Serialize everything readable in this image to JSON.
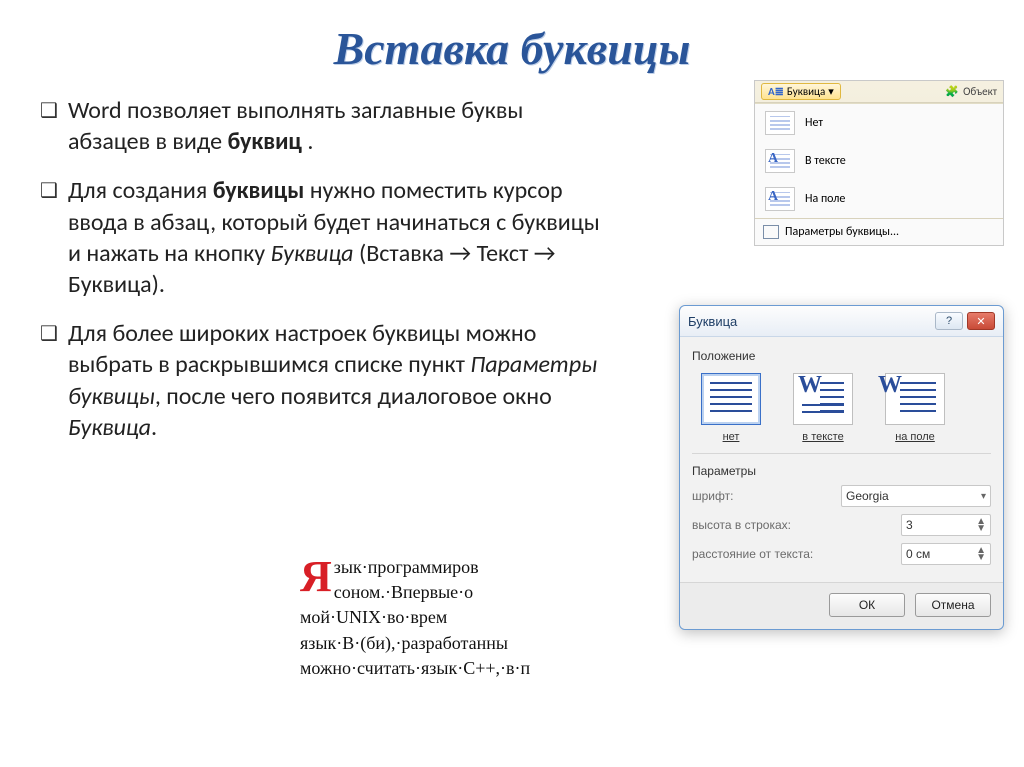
{
  "title": "Вставка буквицы",
  "paragraphs": {
    "p1_a": "Word позволяет выполнять заглавные буквы абзацев в виде ",
    "p1_b": "буквиц",
    "p1_c": " .",
    "p2_a": "Для создания ",
    "p2_b": "буквицы",
    "p2_c": " нужно поместить курсор ввода в абзац, который будет начинаться с буквицы и нажать на кнопку ",
    "p2_d": "Буквица",
    "p2_e": " (Вставка → Текст → Буквица).",
    "p3_a": "Для более широких настроек буквицы можно выбрать в раскрывшимся списке пункт ",
    "p3_b": "Параметры буквицы",
    "p3_c": ", после чего появится диалоговое окно ",
    "p3_d": "Буквица",
    "p3_e": "."
  },
  "ribbon": {
    "button": "Буквица",
    "object": "Объект",
    "items": {
      "none": "Нет",
      "intext": "В тексте",
      "margin": "На поле"
    },
    "footer": "Параметры буквицы..."
  },
  "dialog": {
    "title": "Буквица",
    "group_position": "Положение",
    "positions": {
      "none": "нет",
      "intext": "в тексте",
      "margin": "на поле"
    },
    "group_params": "Параметры",
    "labels": {
      "font": "шрифт:",
      "height": "высота в строках:",
      "distance": "расстояние от текста:"
    },
    "values": {
      "font": "Georgia",
      "height": "3",
      "distance": "0 см"
    },
    "buttons": {
      "ok": "ОК",
      "cancel": "Отмена"
    }
  },
  "example": {
    "dropcap": "Я",
    "l1": "зык·программиров",
    "l2": "соном.·Впервые·о",
    "l3": "мой·UNIX·во·врем",
    "l4": "язык·B·(би),·разработанны",
    "l5": "можно·считать·язык·C++,·в·п"
  }
}
